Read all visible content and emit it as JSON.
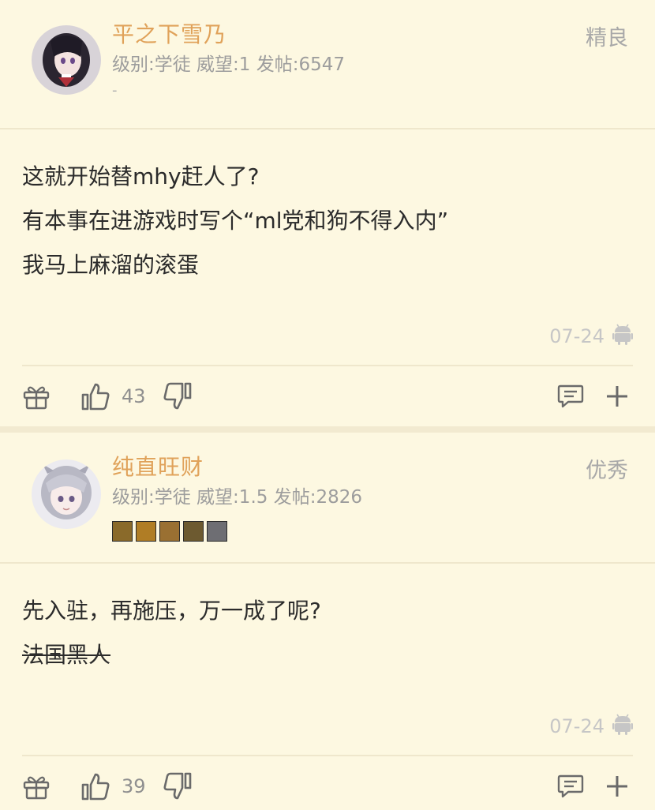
{
  "posts": [
    {
      "username": "平之下雪乃",
      "user_info": "级别:学徒 威望:1 发帖:6547",
      "signature": "-",
      "rating_tag": "精良",
      "content": [
        "这就开始替mhy赶人了?",
        "有本事在进游戏时写个“ml党和狗不得入内”",
        "我马上麻溜的滚蛋"
      ],
      "date": "07-24",
      "likes": "43"
    },
    {
      "username": "纯直旺财",
      "user_info": "级别:学徒 威望:1.5 发帖:2826",
      "rating_tag": "优秀",
      "badges": [
        {
          "name": "badge-1",
          "color": "#8a6a2a"
        },
        {
          "name": "badge-2",
          "color": "#b07d25"
        },
        {
          "name": "badge-3",
          "color": "#9a7032"
        },
        {
          "name": "badge-4",
          "color": "#6d5a30"
        },
        {
          "name": "badge-5",
          "color": "#6e6e73"
        }
      ],
      "content": [
        "先入驻，再施压，万一成了呢?"
      ],
      "content_struck": "法国黑人",
      "date": "07-24",
      "likes": "39"
    }
  ],
  "icons": {
    "gift": "gift-icon",
    "like": "thumbs-up-icon",
    "dislike": "thumbs-down-icon",
    "comment": "comment-icon",
    "add": "plus-icon",
    "platform": "android-icon"
  },
  "colors": {
    "background": "#fdf8e1",
    "username": "#e0a25a",
    "secondary": "#9d9d9d",
    "date": "#c6c6c6"
  }
}
